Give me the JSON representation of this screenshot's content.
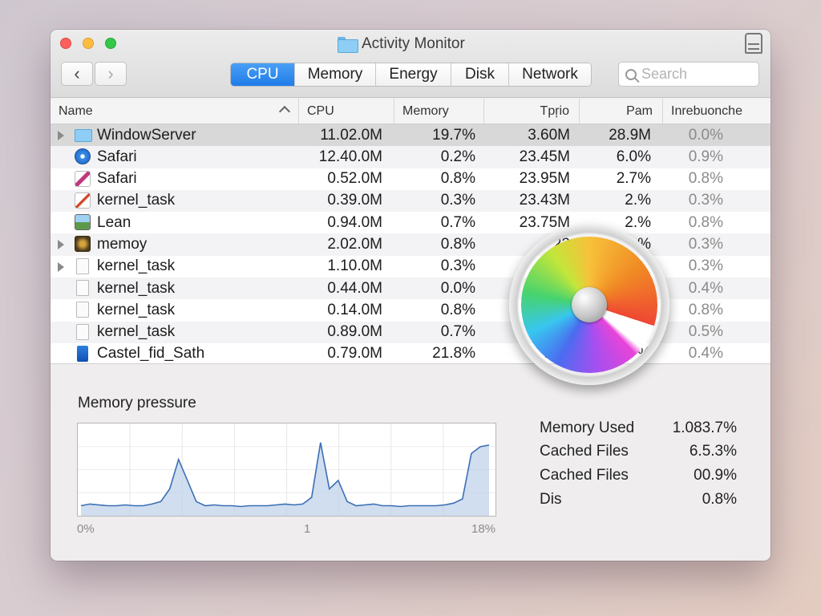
{
  "window": {
    "title": "Activity Monitor"
  },
  "toolbar": {
    "back_label": "‹",
    "forward_label": "›",
    "tabs": [
      {
        "label": "CPU",
        "active": true
      },
      {
        "label": "Memory",
        "active": false
      },
      {
        "label": "Energy",
        "active": false
      },
      {
        "label": "Disk",
        "active": false
      },
      {
        "label": "Network",
        "active": false
      }
    ],
    "search_placeholder": "Search"
  },
  "table": {
    "headers": [
      "Name",
      "CPU",
      "Memory",
      "Tpŗio",
      "Pam",
      "Inrebuonche"
    ],
    "rows": [
      {
        "name": "WindowServer",
        "icon": "folder-icon",
        "expandable": true,
        "selected": true,
        "cpu": "11.02.0M",
        "memory": "19.7%",
        "col4": "3.60M",
        "col5": "28.9M",
        "col6": "0.0%"
      },
      {
        "name": "Safari",
        "icon": "safari-icon",
        "expandable": false,
        "cpu": "12.40.0M",
        "memory": "0.2%",
        "col4": "23.45M",
        "col5": "6.0%",
        "col6": "0.9%"
      },
      {
        "name": "Safari",
        "icon": "script-editor-icon",
        "expandable": false,
        "cpu": "0.52.0M",
        "memory": "0.8%",
        "col4": "23.95M",
        "col5": "2.7%",
        "col6": "0.8%"
      },
      {
        "name": "kernel_task",
        "icon": "pen-document-icon",
        "expandable": false,
        "cpu": "0.39.0M",
        "memory": "0.3%",
        "col4": "23.43M",
        "col5": "2.%",
        "col6": "0.3%"
      },
      {
        "name": "Lean",
        "icon": "image-icon",
        "expandable": false,
        "cpu": "0.94.0M",
        "memory": "0.7%",
        "col4": "23.75M",
        "col5": "2.%",
        "col6": "0.8%"
      },
      {
        "name": "memoy",
        "icon": "game-icon",
        "expandable": true,
        "cpu": "2.02.0M",
        "memory": "0.8%",
        "col4": "22",
        "col5": "%",
        "col6": "0.3%"
      },
      {
        "name": "kernel_task",
        "icon": "document-icon",
        "expandable": true,
        "cpu": "1.10.0M",
        "memory": "0.3%",
        "col4": "",
        "col5": "",
        "col6": "0.3%"
      },
      {
        "name": "kernel_task",
        "icon": "document-icon",
        "expandable": false,
        "cpu": "0.44.0M",
        "memory": "0.0%",
        "col4": "",
        "col5": "",
        "col6": "0.4%"
      },
      {
        "name": "kernel_task",
        "icon": "document-icon",
        "expandable": false,
        "cpu": "0.14.0M",
        "memory": "0.8%",
        "col4": "",
        "col5": "",
        "col6": "0.8%"
      },
      {
        "name": "kernel_task",
        "icon": "document-icon",
        "expandable": false,
        "cpu": "0.89.0M",
        "memory": "0.7%",
        "col4": "",
        "col5": "",
        "col6": "0.5%"
      },
      {
        "name": "Castel_fid_Sath",
        "icon": "blue-app-icon",
        "expandable": false,
        "cpu": "0.79.0M",
        "memory": "21.8%",
        "col4": "213",
        "col5": "%",
        "col6": "0.4%"
      }
    ]
  },
  "memory_pressure": {
    "title": "Memory pressure",
    "axis_labels": [
      "0%",
      "1",
      "18%"
    ],
    "stats": [
      {
        "label": "Memory Used",
        "value": "1.083.7%"
      },
      {
        "label": "Cached Files",
        "value": "6.5.3%"
      },
      {
        "label": "Cached Files",
        "value": "00.9%"
      },
      {
        "label": "Dis",
        "value": "0.8%"
      }
    ]
  },
  "chart_data": {
    "type": "area",
    "title": "Memory pressure",
    "x_tick_labels": [
      "0%",
      "1",
      "18%"
    ],
    "values": [
      0.1,
      0.12,
      0.11,
      0.1,
      0.1,
      0.11,
      0.1,
      0.1,
      0.12,
      0.15,
      0.3,
      0.65,
      0.4,
      0.15,
      0.1,
      0.11,
      0.1,
      0.1,
      0.09,
      0.1,
      0.1,
      0.1,
      0.11,
      0.12,
      0.11,
      0.12,
      0.2,
      0.85,
      0.3,
      0.4,
      0.15,
      0.1,
      0.11,
      0.12,
      0.1,
      0.1,
      0.09,
      0.1,
      0.1,
      0.1,
      0.1,
      0.11,
      0.13,
      0.18,
      0.72,
      0.8,
      0.82
    ]
  },
  "colors": {
    "accent": "#1f7ce8",
    "graph_line": "#3a6fb5",
    "graph_fill": "#bcd0e8"
  }
}
